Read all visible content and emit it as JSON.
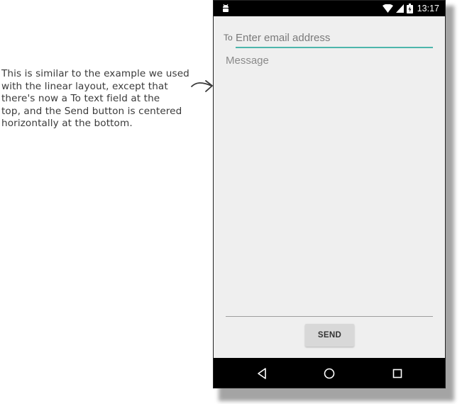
{
  "annotation": {
    "lines": [
      "This is similar to the example we used",
      "with the linear layout, except that",
      "there's now a To text field at the",
      "top, and the Send button is centered",
      "horizontally at the bottom."
    ]
  },
  "status_bar": {
    "time": "13:17",
    "icons": [
      "android-debug-icon",
      "wifi-icon",
      "cell-signal-icon",
      "battery-charging-icon"
    ]
  },
  "form": {
    "to_label": "To",
    "email_placeholder": "Enter email address",
    "message_placeholder": "Message",
    "send_label": "SEND"
  },
  "nav_bar": {
    "icons": [
      "back-icon",
      "home-icon",
      "recents-icon"
    ]
  },
  "colors": {
    "accent": "#4db6ac",
    "background": "#efefef",
    "bar": "#000000",
    "button": "#d8d8d8"
  }
}
